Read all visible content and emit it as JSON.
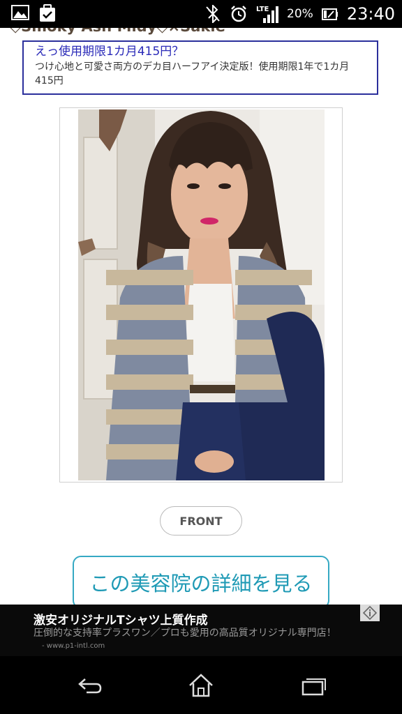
{
  "status_bar": {
    "time": "23:40",
    "battery_percent": "20%",
    "network_label": "LTE",
    "icons": [
      "gallery-icon",
      "clipboard-icon",
      "bluetooth-off-icon",
      "alarm-icon",
      "signal-icon",
      "battery-icon"
    ]
  },
  "page": {
    "truncated_heading": "◇Smoky Ash Midy◇×Sakie",
    "top_ad": {
      "title": "えっ使用期限1カ月415円？",
      "description": "つけ心地と可愛さ両方のデカ目ハーフアイ決定版！使用期限1年で1カ月415円"
    },
    "photo_alt": "hairstyle photo",
    "front_button": "FRONT",
    "salon_button": "この美容院の詳細を見る"
  },
  "ad_banner": {
    "title": "激安オリジナルTシャツ上質作成",
    "description": "圧倒的な支持率プラスワン／プロも愛用の高品質オリジナル専門店！",
    "url": "- www.p1-intl.com"
  },
  "nav_bar": {
    "buttons": [
      "back-icon",
      "home-icon",
      "recent-apps-icon"
    ]
  },
  "colors": {
    "ad_border": "#2b2f9c",
    "ad_title": "#2a2ab8",
    "salon_button": "#1f9ab5",
    "status_bar": "#000000"
  }
}
